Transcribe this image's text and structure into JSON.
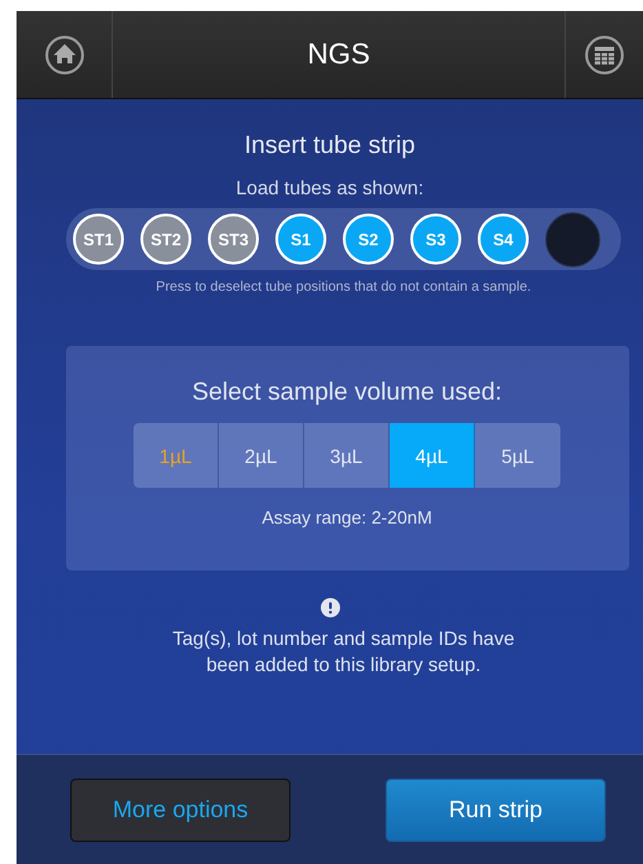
{
  "header": {
    "title": "NGS"
  },
  "instructions": {
    "title": "Insert tube strip",
    "subtitle": "Load tubes as shown:",
    "hint": "Press to deselect tube positions that do not contain a sample."
  },
  "tubes": [
    {
      "label": "ST1",
      "kind": "standard",
      "selected": true
    },
    {
      "label": "ST2",
      "kind": "standard",
      "selected": true
    },
    {
      "label": "ST3",
      "kind": "standard",
      "selected": true
    },
    {
      "label": "S1",
      "kind": "sample",
      "selected": true
    },
    {
      "label": "S2",
      "kind": "sample",
      "selected": true
    },
    {
      "label": "S3",
      "kind": "sample",
      "selected": true
    },
    {
      "label": "S4",
      "kind": "sample",
      "selected": true
    },
    {
      "kind": "empty",
      "selected": false
    }
  ],
  "volume": {
    "title": "Select sample volume used:",
    "options": [
      {
        "label": "1µL",
        "highlight": true,
        "selected": false
      },
      {
        "label": "2µL",
        "highlight": false,
        "selected": false
      },
      {
        "label": "3µL",
        "highlight": false,
        "selected": false
      },
      {
        "label": "4µL",
        "highlight": false,
        "selected": true
      },
      {
        "label": "5µL",
        "highlight": false,
        "selected": false
      }
    ],
    "range": "Assay range: 2-20nM"
  },
  "notice": {
    "text": "Tag(s), lot number and sample IDs have been added to this library setup."
  },
  "buttons": [
    {
      "label": "More options",
      "kind": "secondary"
    },
    {
      "label": "Run strip",
      "kind": "primary"
    }
  ]
}
